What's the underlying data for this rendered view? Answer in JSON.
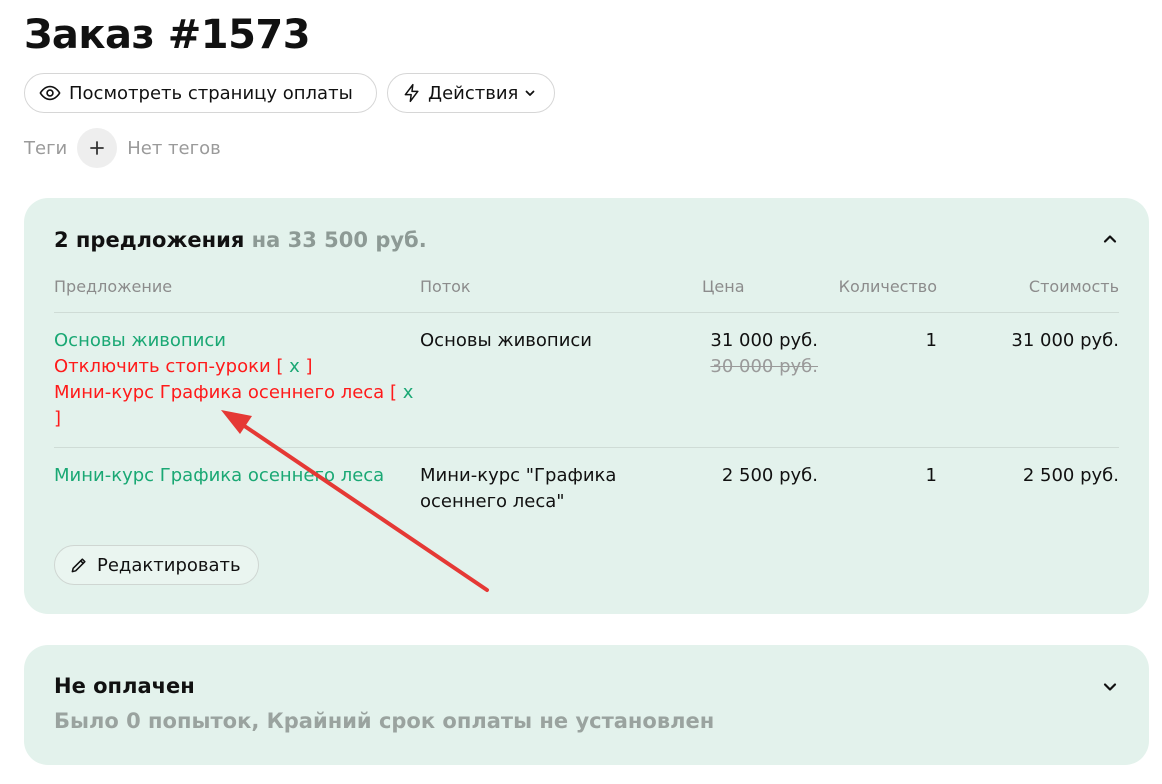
{
  "page": {
    "title": "Заказ #1573"
  },
  "toolbar": {
    "view_payment_label": "Посмотреть страницу оплаты",
    "actions_label": "Действия"
  },
  "tags": {
    "label": "Теги",
    "empty_text": "Нет тегов"
  },
  "offers": {
    "count_text": "2 предложения",
    "sum_text": "на 33 500 руб.",
    "columns": [
      "Предложение",
      "Поток",
      "Цена",
      "Количество",
      "Стоимость"
    ],
    "rows": [
      {
        "offer": "Основы живописи",
        "options": [
          {
            "text": "Отключить стоп-уроки",
            "remove": "x"
          },
          {
            "text": "Мини-курс Графика осеннего леса",
            "remove": "x"
          }
        ],
        "stream": "Основы живописи",
        "price": "31 000 руб.",
        "old_price": "30 000 руб.",
        "qty": "1",
        "total": "31 000 руб."
      },
      {
        "offer": "Мини-курс Графика осеннего леса",
        "stream_line1": "Мини-курс \"Графика",
        "stream_line2": "осеннего леса\"",
        "price": "2 500 руб.",
        "qty": "1",
        "total": "2 500 руб."
      }
    ],
    "edit_label": "Редактировать"
  },
  "payment": {
    "status": "Не оплачен",
    "details": "Было 0 попыток, Крайний срок оплаты не установлен"
  },
  "colors": {
    "card_bg": "#e3f2ec",
    "accent_green": "#1aa874",
    "alert_red": "#ff1a1a",
    "annotation_arrow": "#e53935"
  }
}
